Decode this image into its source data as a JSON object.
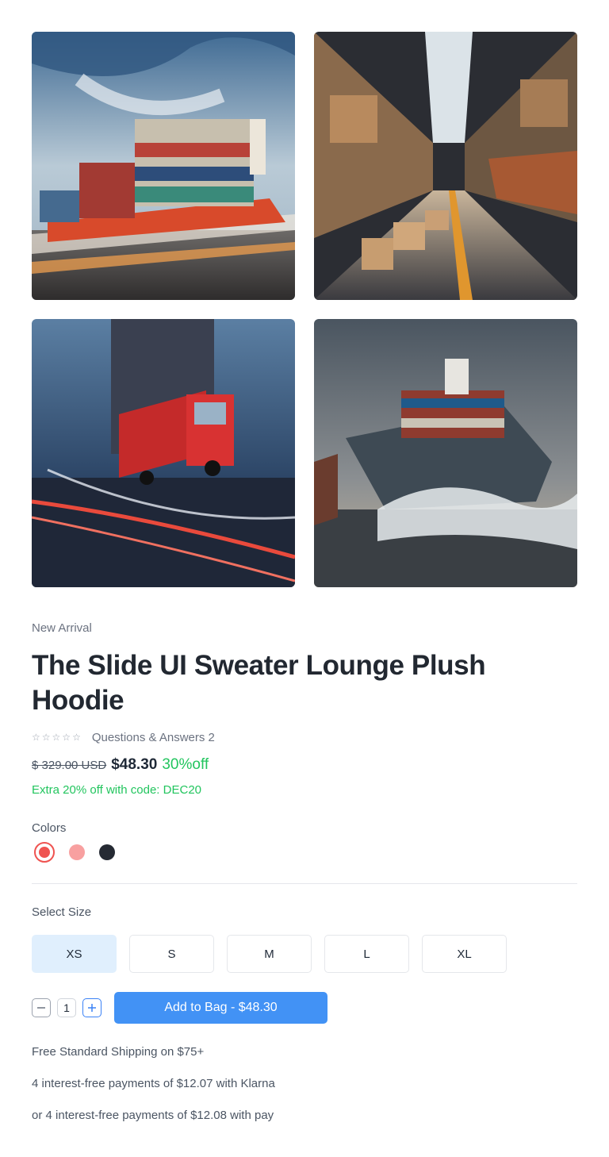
{
  "gallery": {
    "images": [
      {
        "icon": "container-ship-photo"
      },
      {
        "icon": "warehouse-photo"
      },
      {
        "icon": "red-truck-photo"
      },
      {
        "icon": "cargo-ship-waves-photo"
      }
    ]
  },
  "product": {
    "eyebrow": "New Arrival",
    "title": "The Slide UI Sweater Lounge Plush Hoodie",
    "rating": {
      "stars_filled": 0,
      "stars_total": 5,
      "qa_text": "Questions & Answers 2"
    },
    "price": {
      "original": "$ 329.00 USD",
      "current": "$48.30",
      "discount": "30%off",
      "promo": "Extra 20% off with code: DEC20"
    },
    "colors": {
      "label": "Colors",
      "options": [
        {
          "name": "red",
          "hex": "#ef5350",
          "selected": true
        },
        {
          "name": "pink",
          "hex": "#f8a0a0",
          "selected": false
        },
        {
          "name": "charcoal",
          "hex": "#252a33",
          "selected": false
        }
      ]
    },
    "sizes": {
      "label": "Select Size",
      "options": [
        "XS",
        "S",
        "M",
        "L",
        "XL"
      ],
      "selected": "XS"
    },
    "quantity": "1",
    "add_to_bag": "Add to Bag - $48.30",
    "info": [
      "Free Standard Shipping on $75+",
      "4 interest-free payments of $12.07 with Klarna",
      "or 4 interest-free payments of $12.08 with pay"
    ]
  },
  "theme": {
    "accent": "#4292f5",
    "success": "#22c55e",
    "selected_size_bg": "#e0effd"
  }
}
